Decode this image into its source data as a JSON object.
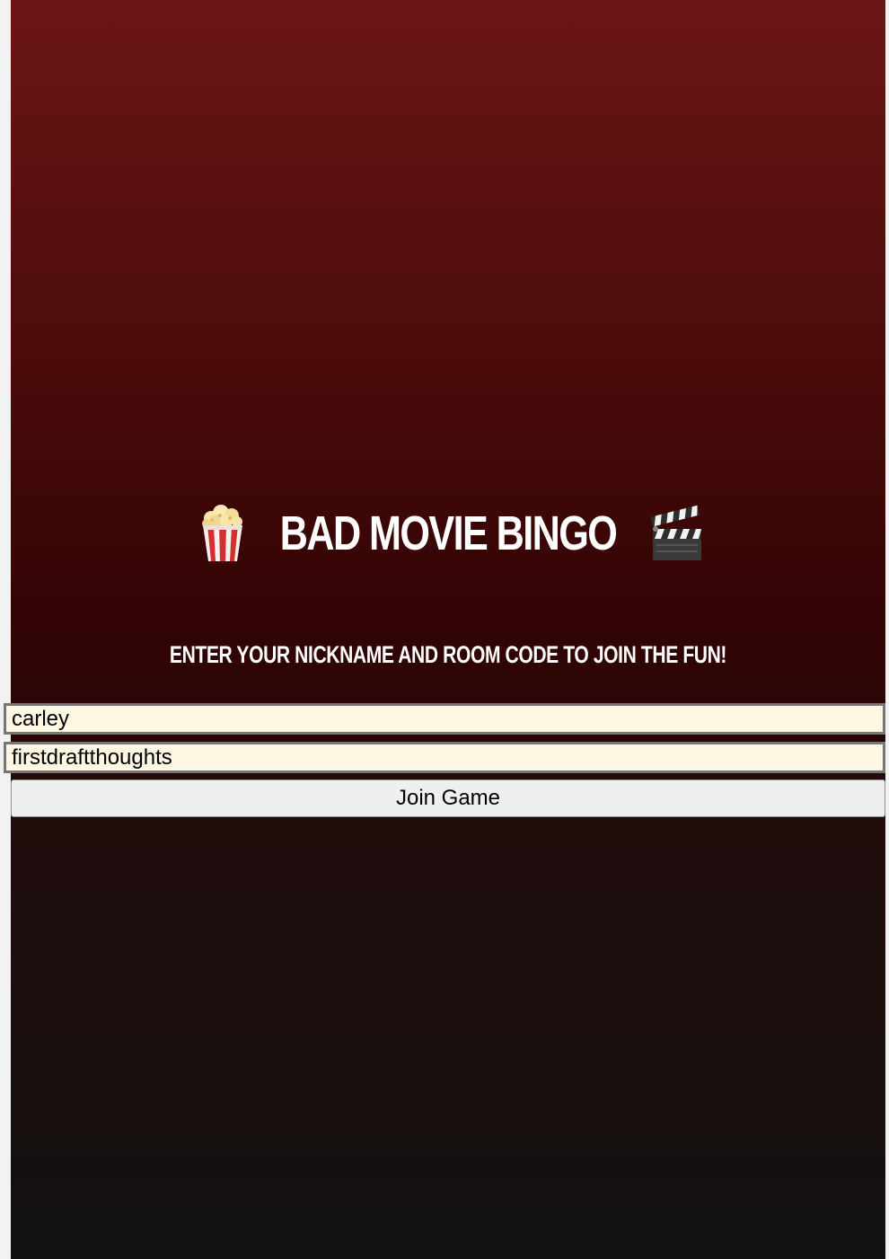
{
  "header": {
    "title": "BAD MOVIE BINGO",
    "left_icon": "popcorn-icon",
    "right_icon": "clapper-board-icon"
  },
  "subtitle": "ENTER YOUR NICKNAME AND ROOM CODE TO JOIN THE FUN!",
  "form": {
    "nickname_value": "carley",
    "room_code_value": "firstdraftthoughts",
    "join_label": "Join Game"
  },
  "colors": {
    "gradient_top": "#6b1614",
    "gradient_mid": "#300404",
    "gradient_bottom": "#111010",
    "input_background": "#fdf6e3",
    "button_background": "#efefef"
  }
}
